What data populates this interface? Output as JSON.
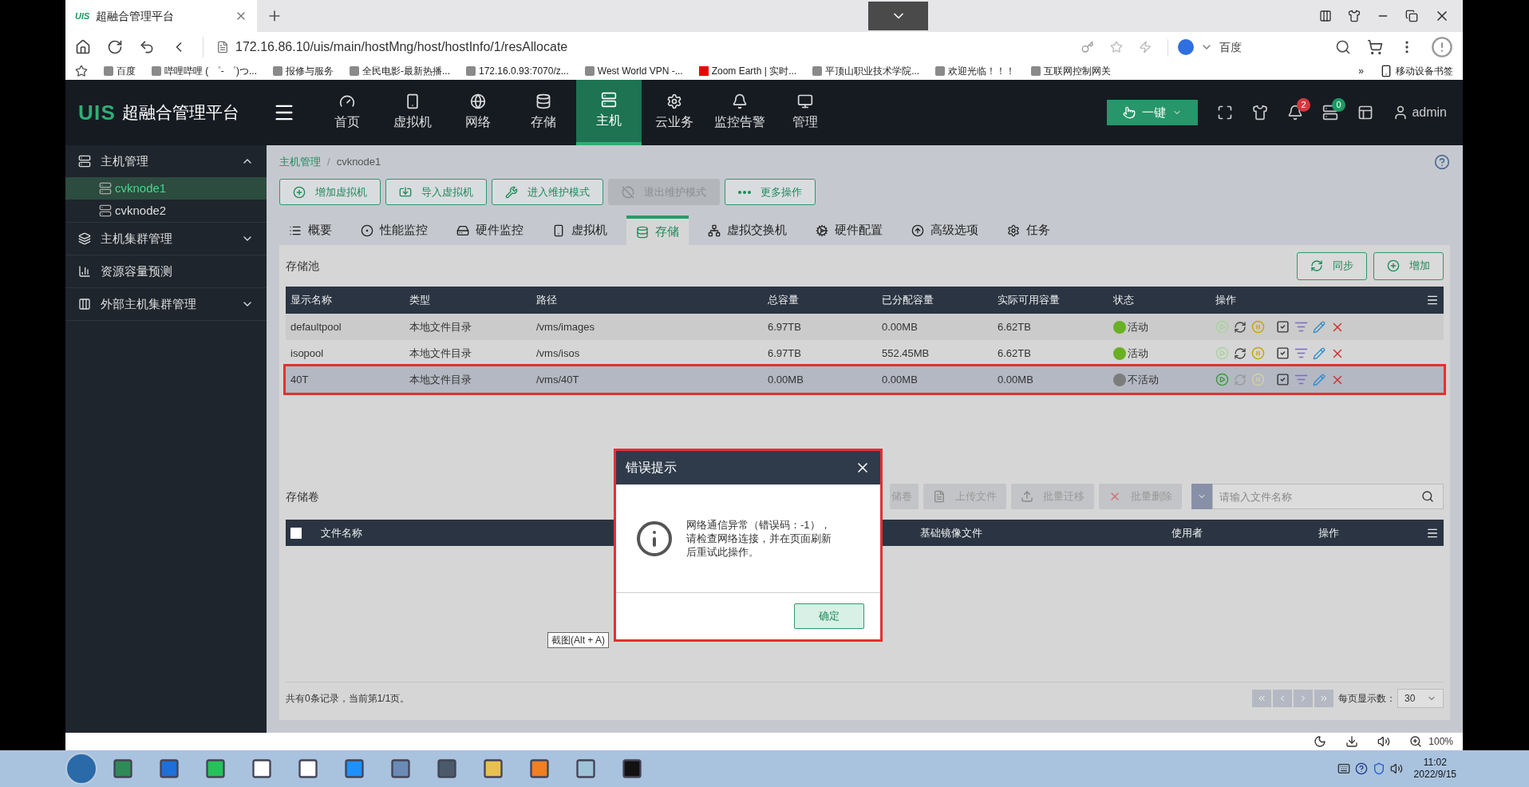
{
  "browser": {
    "tab": {
      "logo": "UIS",
      "title": "超融合管理平台"
    },
    "address": "172.16.86.10/uis/main/hostMng/host/hostInfo/1/resAllocate",
    "search_engine": "百度",
    "bookmarks": [
      "百度",
      "哔哩哔哩 ( ゜- ゜)つ...",
      "报修与服务",
      "全民电影-最新热播...",
      "172.16.0.93:7070/z...",
      "West World VPN -...",
      "Zoom Earth | 实时...",
      "平顶山职业技术学院...",
      "欢迎光临！！！",
      "互联网控制网关"
    ],
    "bookmarks_more": "»",
    "mobile_bookmarks": "移动设备书签",
    "zoom": "100%"
  },
  "app": {
    "logo": "UIS",
    "title": "超融合管理平台",
    "nav": [
      {
        "label": "首页",
        "selected": false
      },
      {
        "label": "虚拟机",
        "selected": false
      },
      {
        "label": "网络",
        "selected": false
      },
      {
        "label": "存储",
        "selected": false
      },
      {
        "label": "主机",
        "selected": true
      },
      {
        "label": "云业务",
        "selected": false
      },
      {
        "label": "监控告警",
        "selected": false
      },
      {
        "label": "管理",
        "selected": false
      }
    ],
    "one_click": "一键",
    "alerts_badge": "2",
    "tasks_badge": "0",
    "user": "admin"
  },
  "sidebar": {
    "items": [
      {
        "label": "主机管理",
        "kind": "group",
        "expanded": true,
        "children": [
          {
            "label": "cvknode1",
            "selected": true
          },
          {
            "label": "cvknode2",
            "selected": false
          }
        ]
      },
      {
        "label": "主机集群管理",
        "kind": "group",
        "expanded": false
      },
      {
        "label": "资源容量预测",
        "kind": "link"
      },
      {
        "label": "外部主机集群管理",
        "kind": "group",
        "expanded": false
      }
    ]
  },
  "breadcrumb": [
    "主机管理",
    "cvknode1"
  ],
  "breadcrumb_separator": "/",
  "actions": [
    {
      "label": "增加虚拟机",
      "disabled": false
    },
    {
      "label": "导入虚拟机",
      "disabled": false
    },
    {
      "label": "进入维护模式",
      "disabled": false
    },
    {
      "label": "退出维护模式",
      "disabled": true
    },
    {
      "label": "更多操作",
      "disabled": false
    }
  ],
  "tabs": [
    {
      "label": "概要",
      "selected": false
    },
    {
      "label": "性能监控",
      "selected": false
    },
    {
      "label": "硬件监控",
      "selected": false
    },
    {
      "label": "虚拟机",
      "selected": false
    },
    {
      "label": "存储",
      "selected": true
    },
    {
      "label": "虚拟交换机",
      "selected": false
    },
    {
      "label": "硬件配置",
      "selected": false
    },
    {
      "label": "高级选项",
      "selected": false
    },
    {
      "label": "任务",
      "selected": false
    }
  ],
  "storage_pool": {
    "title": "存储池",
    "buttons": [
      "同步",
      "增加"
    ],
    "columns": [
      "显示名称",
      "类型",
      "路径",
      "总容量",
      "已分配容量",
      "实际可用容量",
      "状态",
      "操作"
    ],
    "rows": [
      {
        "name": "defaultpool",
        "type": "本地文件目录",
        "path": "/vms/images",
        "total": "6.97TB",
        "allocated": "0.00MB",
        "available": "6.62TB",
        "status": "活动",
        "active": true,
        "selected": false
      },
      {
        "name": "isopool",
        "type": "本地文件目录",
        "path": "/vms/isos",
        "total": "6.97TB",
        "allocated": "552.45MB",
        "available": "6.62TB",
        "status": "活动",
        "active": true,
        "selected": false
      },
      {
        "name": "40T",
        "type": "本地文件目录",
        "path": "/vms/40T",
        "total": "0.00MB",
        "allocated": "0.00MB",
        "available": "0.00MB",
        "status": "不活动",
        "active": false,
        "selected": true
      }
    ]
  },
  "storage_volume": {
    "title": "存储卷",
    "toolbar": [
      "储卷",
      "上传文件",
      "批量迁移",
      "批量删除"
    ],
    "search_placeholder": "请输入文件名称",
    "select_all_checked": false,
    "columns": [
      "文件名称",
      "基础镜像文件",
      "使用者",
      "操作"
    ],
    "footer": "共有0条记录，当前第1/1页。",
    "page_size_label": "每页显示数：",
    "page_size": "30"
  },
  "dialog": {
    "title": "错误提示",
    "message": "网络通信异常（错误码：-1），请检查网络连接，并在页面刷新后重试此操作。",
    "button": "确定"
  },
  "tooltip": "截图(Alt + A)",
  "taskbar": {
    "time": "11:02",
    "date": "2022/9/15"
  }
}
